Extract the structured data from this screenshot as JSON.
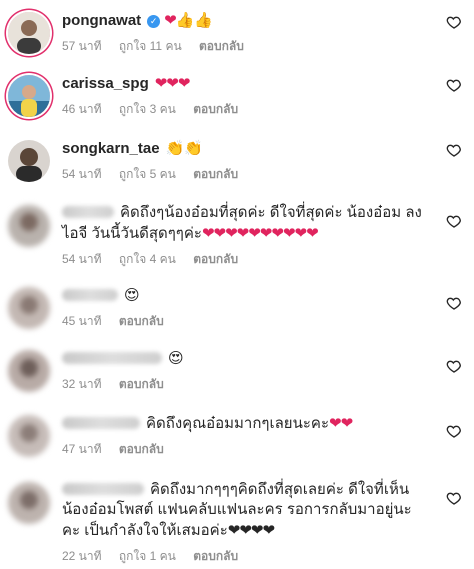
{
  "comments": [
    {
      "username": "pongnawat",
      "verified": true,
      "text": "",
      "emoji": "❤👍👍",
      "time": "57 นาที",
      "likes": "ถูกใจ 11 คน",
      "reply": "ตอบกลับ"
    },
    {
      "username": "carissa_spg",
      "verified": false,
      "text": "",
      "emoji": "❤❤❤",
      "time": "46 นาที",
      "likes": "ถูกใจ 3 คน",
      "reply": "ตอบกลับ"
    },
    {
      "username": "songkarn_tae",
      "verified": false,
      "text": "",
      "emoji": "👏👏",
      "time": "54 นาที",
      "likes": "ถูกใจ 5 คน",
      "reply": "ตอบกลับ"
    },
    {
      "username": "",
      "verified": false,
      "text": "คิดถึงๆน้องอ๋อมที่สุดค่ะ ดีใจที่สุดค่ะ น้องอ๋อม ลงไอจี วันนี้วันดีสุดๆๆค่ะ",
      "emoji": "❤❤❤❤❤❤❤❤❤❤",
      "time": "54 นาที",
      "likes": "ถูกใจ 4 คน",
      "reply": "ตอบกลับ"
    },
    {
      "username": "",
      "verified": false,
      "text": "",
      "emoji": "😍",
      "time": "45 นาที",
      "likes": "",
      "reply": "ตอบกลับ"
    },
    {
      "username": "",
      "verified": false,
      "text": "",
      "emoji": "😍",
      "time": "32 นาที",
      "likes": "",
      "reply": "ตอบกลับ"
    },
    {
      "username": "",
      "verified": false,
      "text": "คิดถึงคุณอ๋อมมากๆเลยนะคะ",
      "emoji": "❤❤",
      "time": "47 นาที",
      "likes": "",
      "reply": "ตอบกลับ"
    },
    {
      "username": "",
      "verified": false,
      "text": "คิดถึงมากๆๆๆคิดถึงที่สุดเลยค่ะ ดีใจที่เห็นน้องอ๋อมโพสต์ แฟนคลับแฟนละคร รอการกลับมาอยู่นะคะ เป็นกำลังใจให้เสมอค่ะ",
      "emoji": "❤❤❤❤",
      "time": "22 นาที",
      "likes": "ถูกใจ 1 คน",
      "reply": "ตอบกลับ"
    }
  ]
}
